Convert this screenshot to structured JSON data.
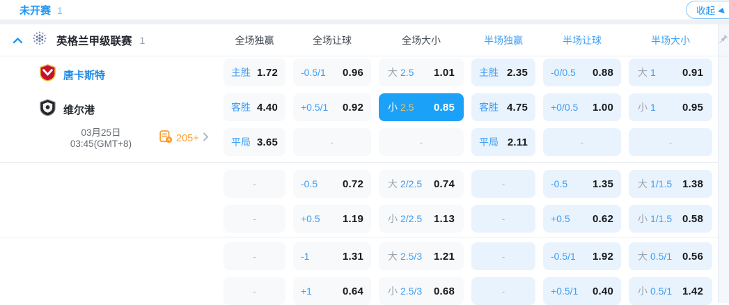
{
  "topbar": {
    "status_label": "未开赛",
    "status_count": "1",
    "collapse_label": "收起"
  },
  "league": {
    "name": "英格兰甲级联赛",
    "count": "1"
  },
  "columns": [
    {
      "label": "全场独赢"
    },
    {
      "label": "全场让球"
    },
    {
      "label": "全场大小"
    },
    {
      "label": "半场独赢"
    },
    {
      "label": "半场让球"
    },
    {
      "label": "半场大小"
    }
  ],
  "match": {
    "home_name": "唐卡斯特",
    "away_name": "维尔港",
    "date_line1": "03月25日",
    "date_line2": "03:45(GMT+8)",
    "markets_count": "205+"
  },
  "colors": {
    "accent": "#2196f3",
    "selected_cell_bg": "#1ba2f8",
    "selected_handicap_gold": "#e8c263",
    "half_cell_bg": "#e9f3fd",
    "full_cell_bg": "#f7f9fb",
    "markets_orange": "#ff9d2e"
  },
  "odds": {
    "rows": [
      {
        "cells": [
          {
            "label": "主胜",
            "value": "1.72"
          },
          {
            "num": "-0.5/1",
            "value": "0.96"
          },
          {
            "prefix": "大",
            "num": "2.5",
            "value": "1.01"
          },
          {
            "label": "主胜",
            "value": "2.35"
          },
          {
            "num": "-0/0.5",
            "value": "0.88"
          },
          {
            "prefix": "大",
            "num": "1",
            "value": "0.91"
          }
        ]
      },
      {
        "cells": [
          {
            "label": "客胜",
            "value": "4.40"
          },
          {
            "num": "+0.5/1",
            "value": "0.92"
          },
          {
            "prefix": "小",
            "num": "2.5",
            "value": "0.85",
            "selected": true
          },
          {
            "label": "客胜",
            "value": "4.75"
          },
          {
            "num": "+0/0.5",
            "value": "1.00"
          },
          {
            "prefix": "小",
            "num": "1",
            "value": "0.95"
          }
        ]
      },
      {
        "cells": [
          {
            "label": "平局",
            "value": "3.65"
          },
          {
            "dash": "-"
          },
          {
            "dash": "-"
          },
          {
            "label": "平局",
            "value": "2.11"
          },
          {
            "dash": "-"
          },
          {
            "dash": "-"
          }
        ]
      },
      {
        "cells": [
          {
            "dash": "-"
          },
          {
            "num": "-0.5",
            "value": "0.72"
          },
          {
            "prefix": "大",
            "num": "2/2.5",
            "value": "0.74"
          },
          {
            "dash": "-"
          },
          {
            "num": "-0.5",
            "value": "1.35"
          },
          {
            "prefix": "大",
            "num": "1/1.5",
            "value": "1.38"
          }
        ]
      },
      {
        "cells": [
          {
            "dash": "-"
          },
          {
            "num": "+0.5",
            "value": "1.19"
          },
          {
            "prefix": "小",
            "num": "2/2.5",
            "value": "1.13"
          },
          {
            "dash": "-"
          },
          {
            "num": "+0.5",
            "value": "0.62"
          },
          {
            "prefix": "小",
            "num": "1/1.5",
            "value": "0.58"
          }
        ]
      },
      {
        "cells": [
          {
            "dash": "-"
          },
          {
            "num": "-1",
            "value": "1.31"
          },
          {
            "prefix": "大",
            "num": "2.5/3",
            "value": "1.21"
          },
          {
            "dash": "-"
          },
          {
            "num": "-0.5/1",
            "value": "1.92"
          },
          {
            "prefix": "大",
            "num": "0.5/1",
            "value": "0.56"
          }
        ]
      },
      {
        "cells": [
          {
            "dash": "-"
          },
          {
            "num": "+1",
            "value": "0.64"
          },
          {
            "prefix": "小",
            "num": "2.5/3",
            "value": "0.68"
          },
          {
            "dash": "-"
          },
          {
            "num": "+0.5/1",
            "value": "0.40"
          },
          {
            "prefix": "小",
            "num": "0.5/1",
            "value": "1.42"
          }
        ]
      }
    ]
  }
}
